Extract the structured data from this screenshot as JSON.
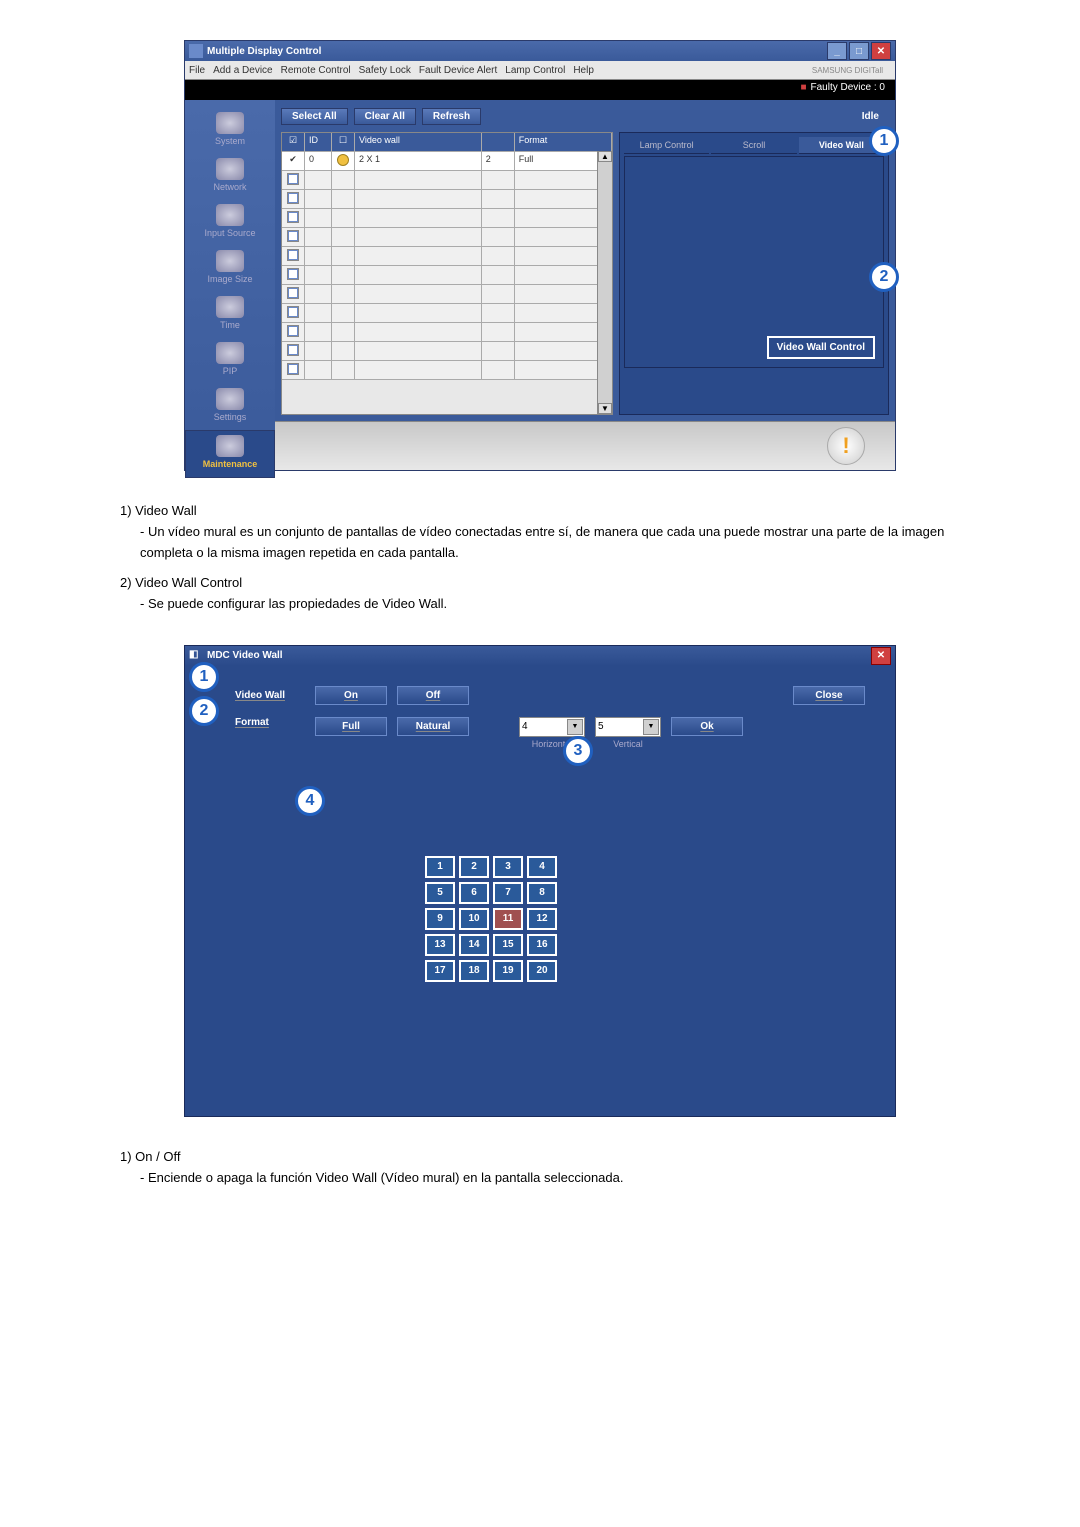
{
  "app1": {
    "title": "Multiple Display Control",
    "menu": [
      "File",
      "Add a Device",
      "Remote Control",
      "Safety Lock",
      "Fault Device Alert",
      "Lamp Control",
      "Help"
    ],
    "brand": "SAMSUNG DIGITall",
    "faulty": "Faulty Device : 0",
    "sidebar": [
      "System",
      "Network",
      "Input Source",
      "Image Size",
      "Time",
      "PIP",
      "Settings",
      "Maintenance"
    ],
    "toolbar": {
      "select_all": "Select All",
      "clear_all": "Clear All",
      "refresh": "Refresh",
      "idle": "Idle"
    },
    "grid": {
      "headers": {
        "chk": "☑",
        "id": "ID",
        "dot": "☐",
        "videowall": "Video wall",
        "n": "",
        "format": "Format"
      },
      "row": {
        "id": "0",
        "vw": "2 X 1",
        "n": "2",
        "fmt": "Full"
      }
    },
    "rtabs": [
      "Lamp Control",
      "Scroll",
      "Video Wall"
    ],
    "vwc": "Video Wall Control",
    "callouts": {
      "c1": "1",
      "c2": "2"
    }
  },
  "text1": {
    "l1": "1)  Video Wall",
    "l1s": "-  Un vídeo mural es un conjunto de pantallas de vídeo conectadas entre sí, de manera que cada una puede mostrar una parte de la imagen completa o la misma imagen repetida en cada pantalla.",
    "l2": "2)  Video Wall Control",
    "l2s": "-  Se puede configurar las propiedades de Video Wall."
  },
  "app2": {
    "title": "MDC Video Wall",
    "row1": {
      "label": "Video Wall",
      "b1": "On",
      "b2": "Off",
      "close": "Close"
    },
    "row2": {
      "label": "Format",
      "b1": "Full",
      "b2": "Natural",
      "h": "4",
      "v": "5",
      "hl": "Horizontal",
      "vl": "Vertical",
      "ok": "Ok"
    },
    "callouts": {
      "c1": "1",
      "c2": "2",
      "c3": "3",
      "c4": "4"
    },
    "cells": [
      1,
      2,
      3,
      4,
      5,
      6,
      7,
      8,
      9,
      10,
      11,
      12,
      13,
      14,
      15,
      16,
      17,
      18,
      19,
      20
    ],
    "selected": 11
  },
  "text2": {
    "l1": "1)  On / Off",
    "l1s": "-  Enciende o apaga la función Video Wall (Vídeo mural) en la pantalla seleccionada."
  }
}
